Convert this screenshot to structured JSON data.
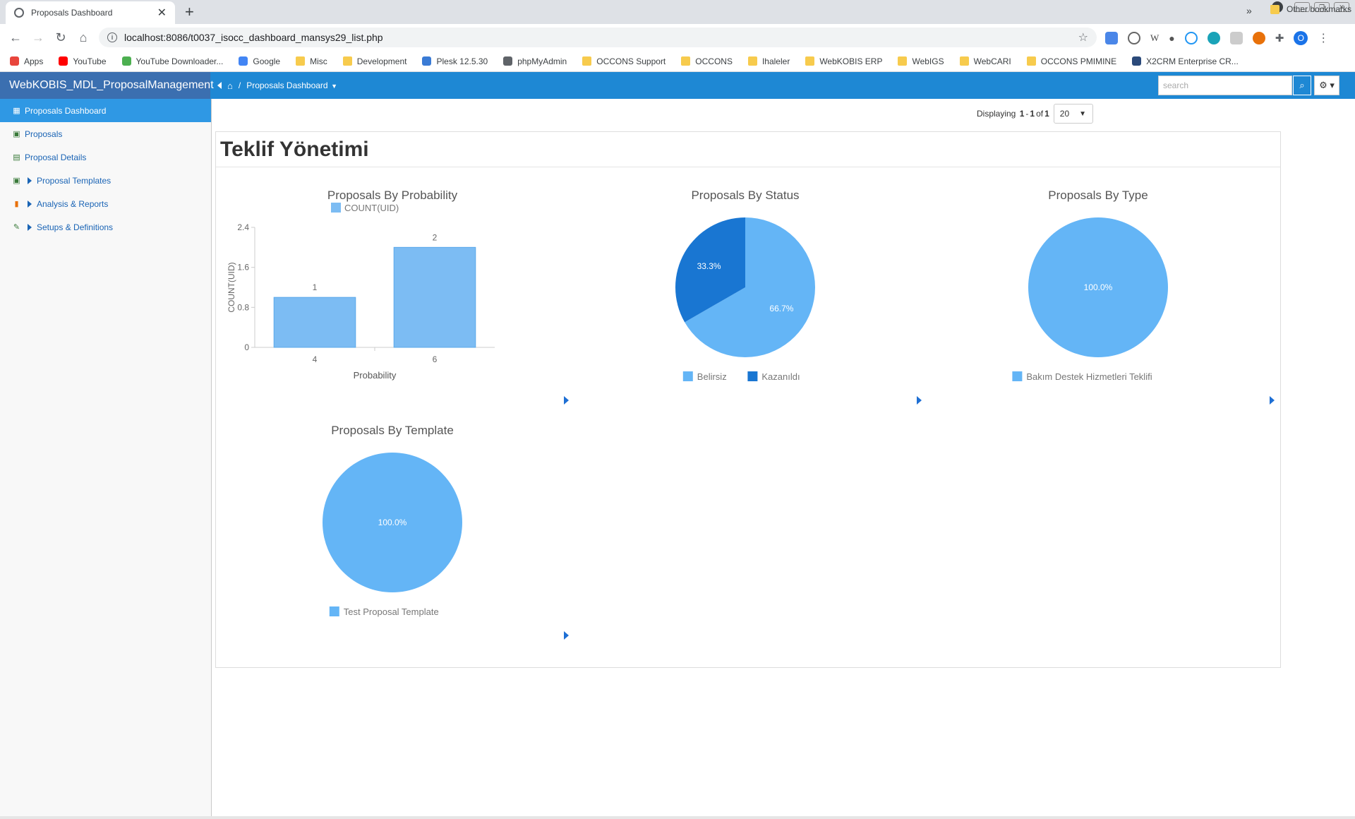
{
  "browser": {
    "tab_title": "Proposals Dashboard",
    "url": "localhost:8086/t0037_isocc_dashboard_mansys29_list.php",
    "avatar_letter": "O",
    "bookmarks": [
      {
        "label": "Apps",
        "icon": "apps-grid-icon",
        "color": "#e8453c"
      },
      {
        "label": "YouTube",
        "icon": "youtube-icon",
        "color": "#ff0000"
      },
      {
        "label": "YouTube Downloader...",
        "icon": "download-arrow-icon",
        "color": "#4caf50"
      },
      {
        "label": "Google",
        "icon": "google-icon",
        "color": "#4285f4"
      },
      {
        "label": "Misc",
        "icon": "folder-icon",
        "color": "#f7cb4d"
      },
      {
        "label": "Development",
        "icon": "folder-icon",
        "color": "#f7cb4d"
      },
      {
        "label": "Plesk 12.5.30",
        "icon": "plesk-icon",
        "color": "#3a7bd5"
      },
      {
        "label": "phpMyAdmin",
        "icon": "globe-icon",
        "color": "#5f6368"
      },
      {
        "label": "OCCONS Support",
        "icon": "folder-icon",
        "color": "#f7cb4d"
      },
      {
        "label": "OCCONS",
        "icon": "folder-icon",
        "color": "#f7cb4d"
      },
      {
        "label": "Ihaleler",
        "icon": "folder-icon",
        "color": "#f7cb4d"
      },
      {
        "label": "WebKOBIS ERP",
        "icon": "folder-icon",
        "color": "#f7cb4d"
      },
      {
        "label": "WebIGS",
        "icon": "folder-icon",
        "color": "#f7cb4d"
      },
      {
        "label": "WebCARI",
        "icon": "folder-icon",
        "color": "#f7cb4d"
      },
      {
        "label": "OCCONS PMIMINE",
        "icon": "folder-icon",
        "color": "#f7cb4d"
      },
      {
        "label": "X2CRM Enterprise CR...",
        "icon": "x2crm-icon",
        "color": "#2b4a7a"
      }
    ],
    "more_bookmarks": "»",
    "other_bookmarks": "Other bookmarks"
  },
  "app": {
    "brand": "WebKOBIS_MDL_ProposalManagement",
    "breadcrumb_sep": "/",
    "breadcrumb_current": "Proposals Dashboard",
    "search_placeholder": "search"
  },
  "sidebar": {
    "items": [
      {
        "label": "Proposals Dashboard",
        "icon": "dashboard-grid-icon",
        "active": true,
        "expandable": false
      },
      {
        "label": "Proposals",
        "icon": "proposal-icon",
        "active": false,
        "expandable": false
      },
      {
        "label": "Proposal Details",
        "icon": "details-icon",
        "active": false,
        "expandable": false
      },
      {
        "label": "Proposal Templates",
        "icon": "template-icon",
        "active": false,
        "expandable": true
      },
      {
        "label": "Analysis & Reports",
        "icon": "bar-chart-icon",
        "active": false,
        "expandable": true
      },
      {
        "label": "Setups & Definitions",
        "icon": "wrench-icon",
        "active": false,
        "expandable": true
      }
    ]
  },
  "pager": {
    "prefix": "Displaying",
    "from": "1",
    "dash": "-",
    "to": "1",
    "of_label": "of",
    "total": "1",
    "page_size": "20"
  },
  "panel": {
    "title": "Teklif Yönetimi"
  },
  "colors": {
    "light_blue": "#64b5f6",
    "dark_blue": "#1976d2",
    "bar_blue": "#7cbcf3"
  },
  "chart_data": [
    {
      "type": "bar",
      "title": "Proposals By Probability",
      "legend": [
        "COUNT(UID)"
      ],
      "categories": [
        "4",
        "6"
      ],
      "values": [
        1,
        2
      ],
      "xlabel": "Probability",
      "ylabel": "COUNT(UID)",
      "ylim": [
        0,
        2.4
      ],
      "yticks": [
        "0",
        "0.8",
        "1.6",
        "2.4"
      ]
    },
    {
      "type": "pie",
      "title": "Proposals By Status",
      "labels": [
        "Belirsiz",
        "Kazanıldı"
      ],
      "values": [
        66.7,
        33.3
      ],
      "value_labels": [
        "66.7%",
        "33.3%"
      ]
    },
    {
      "type": "pie",
      "title": "Proposals By Type",
      "labels": [
        "Bakım Destek Hizmetleri Teklifi"
      ],
      "values": [
        100.0
      ],
      "value_labels": [
        "100.0%"
      ]
    },
    {
      "type": "pie",
      "title": "Proposals By Template",
      "labels": [
        "Test Proposal Template"
      ],
      "values": [
        100.0
      ],
      "value_labels": [
        "100.0%"
      ]
    }
  ]
}
